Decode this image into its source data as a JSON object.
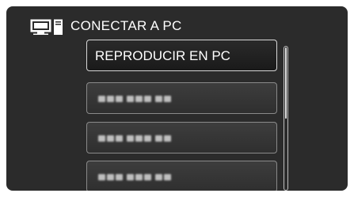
{
  "header": {
    "icon": "pc-icon",
    "title": "CONECTAR A PC"
  },
  "menu": {
    "items": [
      {
        "label": "REPRODUCIR EN PC",
        "selected": true
      },
      {
        "label": "",
        "placeholder": true
      },
      {
        "label": "",
        "placeholder": true
      },
      {
        "label": "",
        "placeholder": true
      }
    ]
  },
  "scroll": {
    "position": 0
  },
  "colors": {
    "background": "#2b2b2b",
    "text": "#ffffff",
    "item_border": "#8a8a8a",
    "selected_border": "#d8d8d8"
  }
}
